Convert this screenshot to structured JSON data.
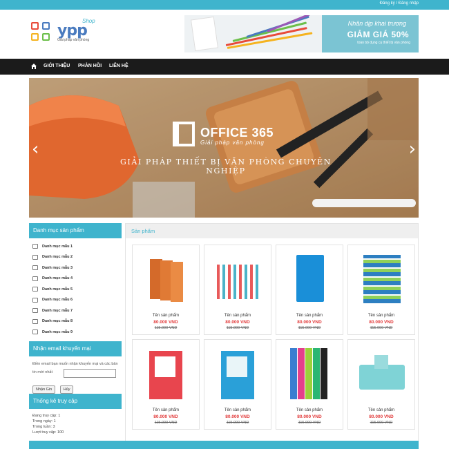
{
  "top": {
    "links": "Đăng ký / Đăng nhập"
  },
  "logo": {
    "text": "ypp",
    "shop": "Shop",
    "tagline": "Giải pháp văn phòng"
  },
  "banner": {
    "line1": "Nhân dịp khai trương",
    "line2": "GIẢM GIÁ 50%",
    "line3": "toàn bộ dụng cụ thiết bị văn phòng"
  },
  "nav": {
    "items": [
      "GIỚI THIỆU",
      "PHẢN HỒI",
      "LIÊN HỆ"
    ]
  },
  "slider": {
    "brand": "OFFICE 365",
    "brand_sub": "Giải pháp văn phòng",
    "slogan": "GIẢI PHÁP THIẾT BỊ VĂN PHÒNG CHUYÊN NGHIỆP",
    "prev": "‹",
    "next": "›"
  },
  "sidebar": {
    "category_title": "Danh mục sản phẩm",
    "categories": [
      "Danh mục mẫu 1",
      "Danh mục mẫu 2",
      "Danh mục mẫu 3",
      "Danh mục mẫu 4",
      "Danh mục mẫu 5",
      "Danh mục mẫu 6",
      "Danh mục mẫu 7",
      "Danh mục mẫu 8",
      "Danh mục mẫu 9"
    ],
    "promo_title": "Nhận email khuyến mại",
    "promo_text": "Điền email bạn muốn nhận khuyến mại và các bản tin mới nhất",
    "submit_label": "Nhận Gin",
    "cancel_label": "Hủy",
    "stats_title": "Thống kê truy cập",
    "stats": [
      "Đang truy cập: 1",
      "Trong ngày: 1",
      "Trong tuần: 3",
      "Lượt truy cập: 100"
    ]
  },
  "main": {
    "title": "Sản phẩm",
    "products": [
      {
        "name": "Tên sản phẩm",
        "price": "80.000 VND",
        "old": "115.000 VND"
      },
      {
        "name": "Tên sản phẩm",
        "price": "80.000 VND",
        "old": "115.000 VND"
      },
      {
        "name": "Tên sản phẩm",
        "price": "80.000 VND",
        "old": "115.000 VND"
      },
      {
        "name": "Tên sản phẩm",
        "price": "80.000 VND",
        "old": "115.000 VND"
      },
      {
        "name": "Tên sản phẩm",
        "price": "80.000 VND",
        "old": "115.000 VND"
      },
      {
        "name": "Tên sản phẩm",
        "price": "80.000 VND",
        "old": "115.000 VND"
      },
      {
        "name": "Tên sản phẩm",
        "price": "80.000 VND",
        "old": "115.000 VND"
      },
      {
        "name": "Tên sản phẩm",
        "price": "80.000 VND",
        "old": "115.000 VND"
      }
    ]
  },
  "colors": {
    "accent": "#3fb4cd",
    "nav": "#1b1b1b",
    "price": "#e23b3b"
  }
}
